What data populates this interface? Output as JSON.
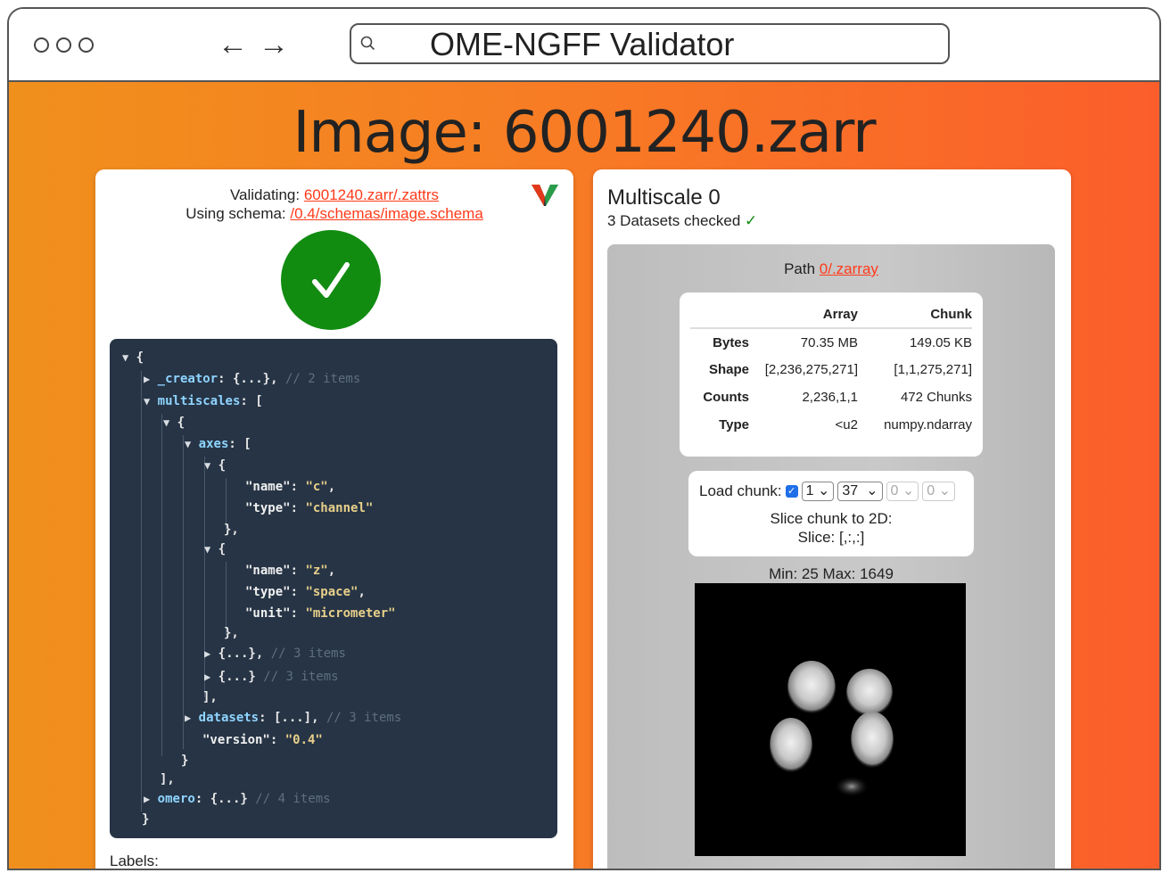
{
  "browser": {
    "back_label": "←",
    "forward_label": "→",
    "url_text": "OME-NGFF Validator"
  },
  "page": {
    "title": "Image: 6001240.zarr"
  },
  "validator": {
    "validating_label": "Validating:",
    "validating_link": "6001240.zarr/.zattrs",
    "schema_label": "Using schema:",
    "schema_link": "/0.4/schemas/image.schema",
    "check_glyph": "✓",
    "json": {
      "open_brace": "{",
      "creator_key": "_creator",
      "creator_collapsed": "{...},",
      "creator_comment": "// 2 items",
      "multiscales_key": "multiscales",
      "open_bracket": "[",
      "axes_key": "axes",
      "name_key": "\"name\"",
      "type_key": "\"type\"",
      "unit_key": "\"unit\"",
      "axis0_name": "\"c\"",
      "axis0_type": "\"channel\"",
      "axis1_name": "\"z\"",
      "axis1_type": "\"space\"",
      "axis1_unit": "\"micrometer\"",
      "close_obj_comma": "},",
      "axis2_collapsed": "{...},",
      "axis2_comment": "// 3 items",
      "axis3_collapsed": "{...}",
      "axis3_comment": "// 3 items",
      "close_bracket_comma": "],",
      "datasets_key": "datasets",
      "datasets_collapsed": "[...],",
      "datasets_comment": "// 3 items",
      "version_key": "\"version\"",
      "version_value": "\"0.4\"",
      "close_brace": "}",
      "omero_key": "omero",
      "omero_collapsed": "{...}",
      "omero_comment": "// 4 items"
    },
    "labels_label": "Labels:"
  },
  "multiscale": {
    "title": "Multiscale 0",
    "datasets_checked": "3 Datasets checked",
    "ok_glyph": "✓",
    "path_label": "Path",
    "path_link": "0/.zarray",
    "table": {
      "headers": [
        "",
        "Array",
        "Chunk"
      ],
      "rows": [
        {
          "label": "Bytes",
          "array": "70.35 MB",
          "chunk": "149.05 KB"
        },
        {
          "label": "Shape",
          "array": "[2,236,275,271]",
          "chunk": "[1,1,275,271]"
        },
        {
          "label": "Counts",
          "array": "2,236,1,1",
          "chunk": "472 Chunks"
        },
        {
          "label": "Type",
          "array": "<u2",
          "chunk": "numpy.ndarray"
        }
      ]
    },
    "load_chunk_label": "Load chunk:",
    "selects": [
      "1",
      "37",
      "0",
      "0"
    ],
    "slice_label": "Slice chunk to 2D:",
    "slice_value": "Slice: [,:,:]",
    "minmax": "Min: 25 Max: 1649"
  }
}
